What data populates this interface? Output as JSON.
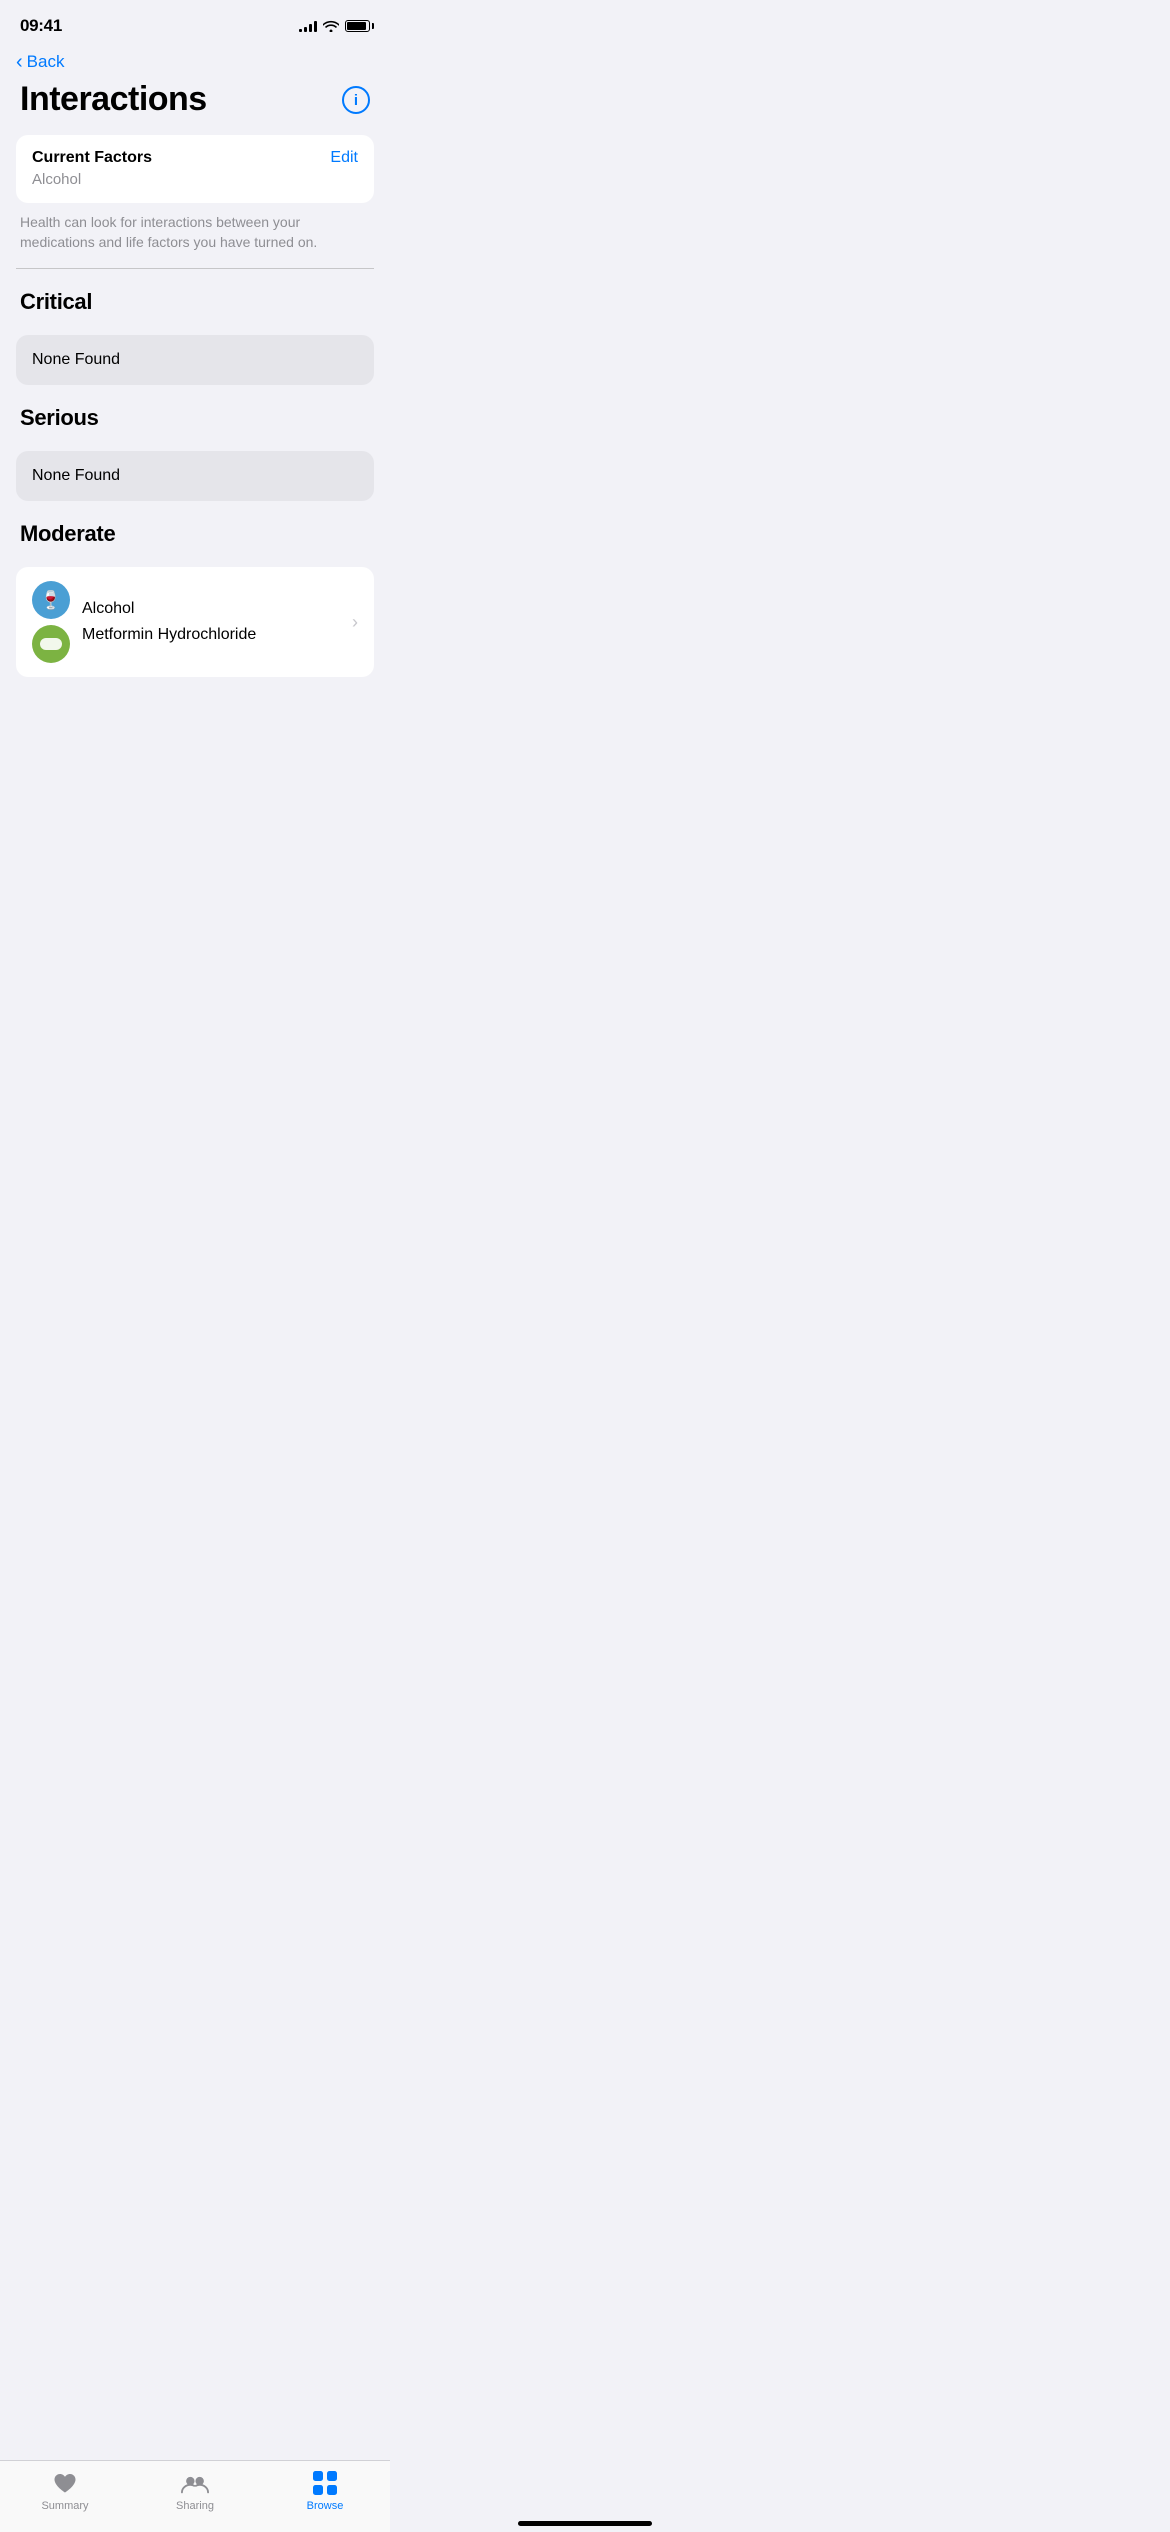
{
  "statusBar": {
    "time": "09:41"
  },
  "nav": {
    "backLabel": "Back"
  },
  "header": {
    "title": "Interactions",
    "infoLabel": "i"
  },
  "currentFactors": {
    "title": "Current Factors",
    "editLabel": "Edit",
    "factor": "Alcohol",
    "helperText": "Health can look for interactions between your medications and life factors you have turned on."
  },
  "sections": {
    "critical": {
      "title": "Critical",
      "noneFound": "None Found"
    },
    "serious": {
      "title": "Serious",
      "noneFound": "None Found"
    },
    "moderate": {
      "title": "Moderate",
      "interaction": {
        "label1": "Alcohol",
        "label2": "Metformin Hydrochloride"
      }
    }
  },
  "tabBar": {
    "summary": "Summary",
    "sharing": "Sharing",
    "browse": "Browse"
  }
}
